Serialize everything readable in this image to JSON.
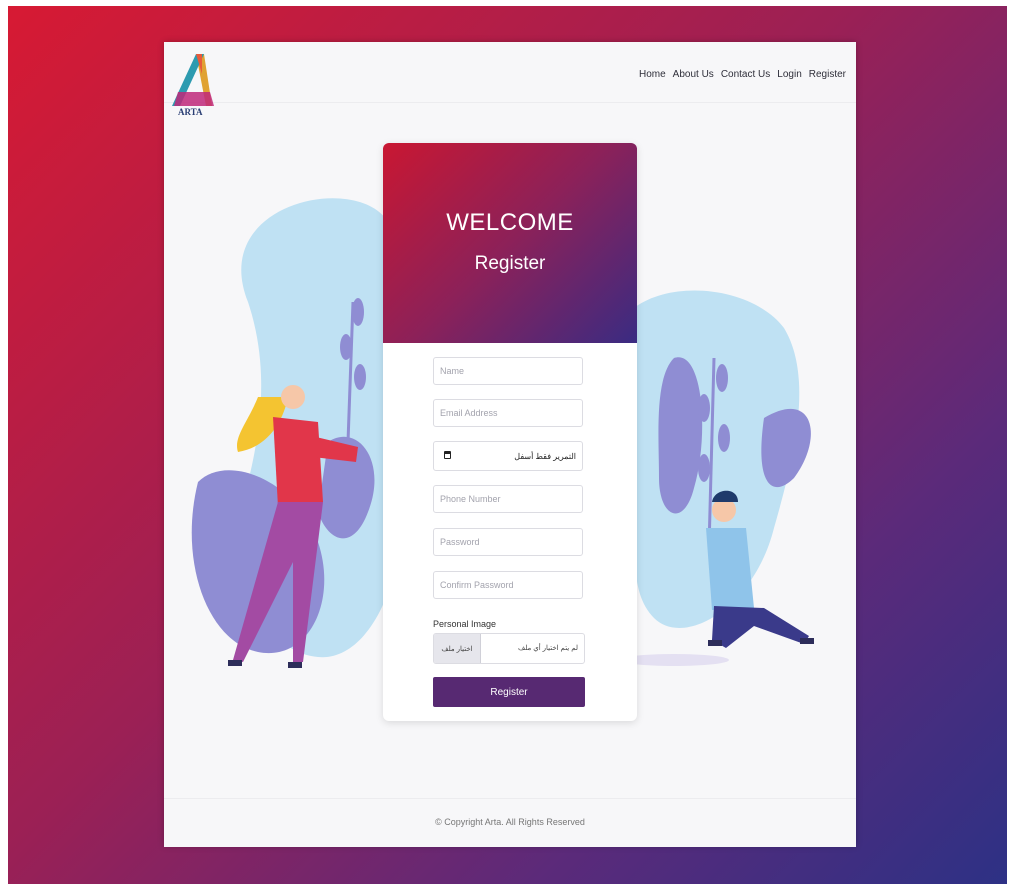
{
  "brand": {
    "logo_text": "ARTA"
  },
  "nav": {
    "items": [
      "Home",
      "About Us",
      "Contact Us",
      "Login",
      "Register"
    ]
  },
  "form": {
    "welcome": "WELCOME",
    "subtitle": "Register",
    "name_placeholder": "Name",
    "email_placeholder": "Email Address",
    "date_text": "التمرير فقط أسفل",
    "phone_placeholder": "Phone Number",
    "password_placeholder": "Password",
    "confirm_placeholder": "Confirm Password",
    "image_label": "Personal Image",
    "file_button": "اختيار ملف",
    "file_status": "لم يتم اختيار أي ملف",
    "submit_label": "Register"
  },
  "footer": {
    "copyright": "© Copyright Arta. All Rights Reserved"
  },
  "colors": {
    "gradient_start": "#d71a33",
    "gradient_end": "#2d3185",
    "button": "#572972",
    "blob": "#bfe1f3"
  }
}
